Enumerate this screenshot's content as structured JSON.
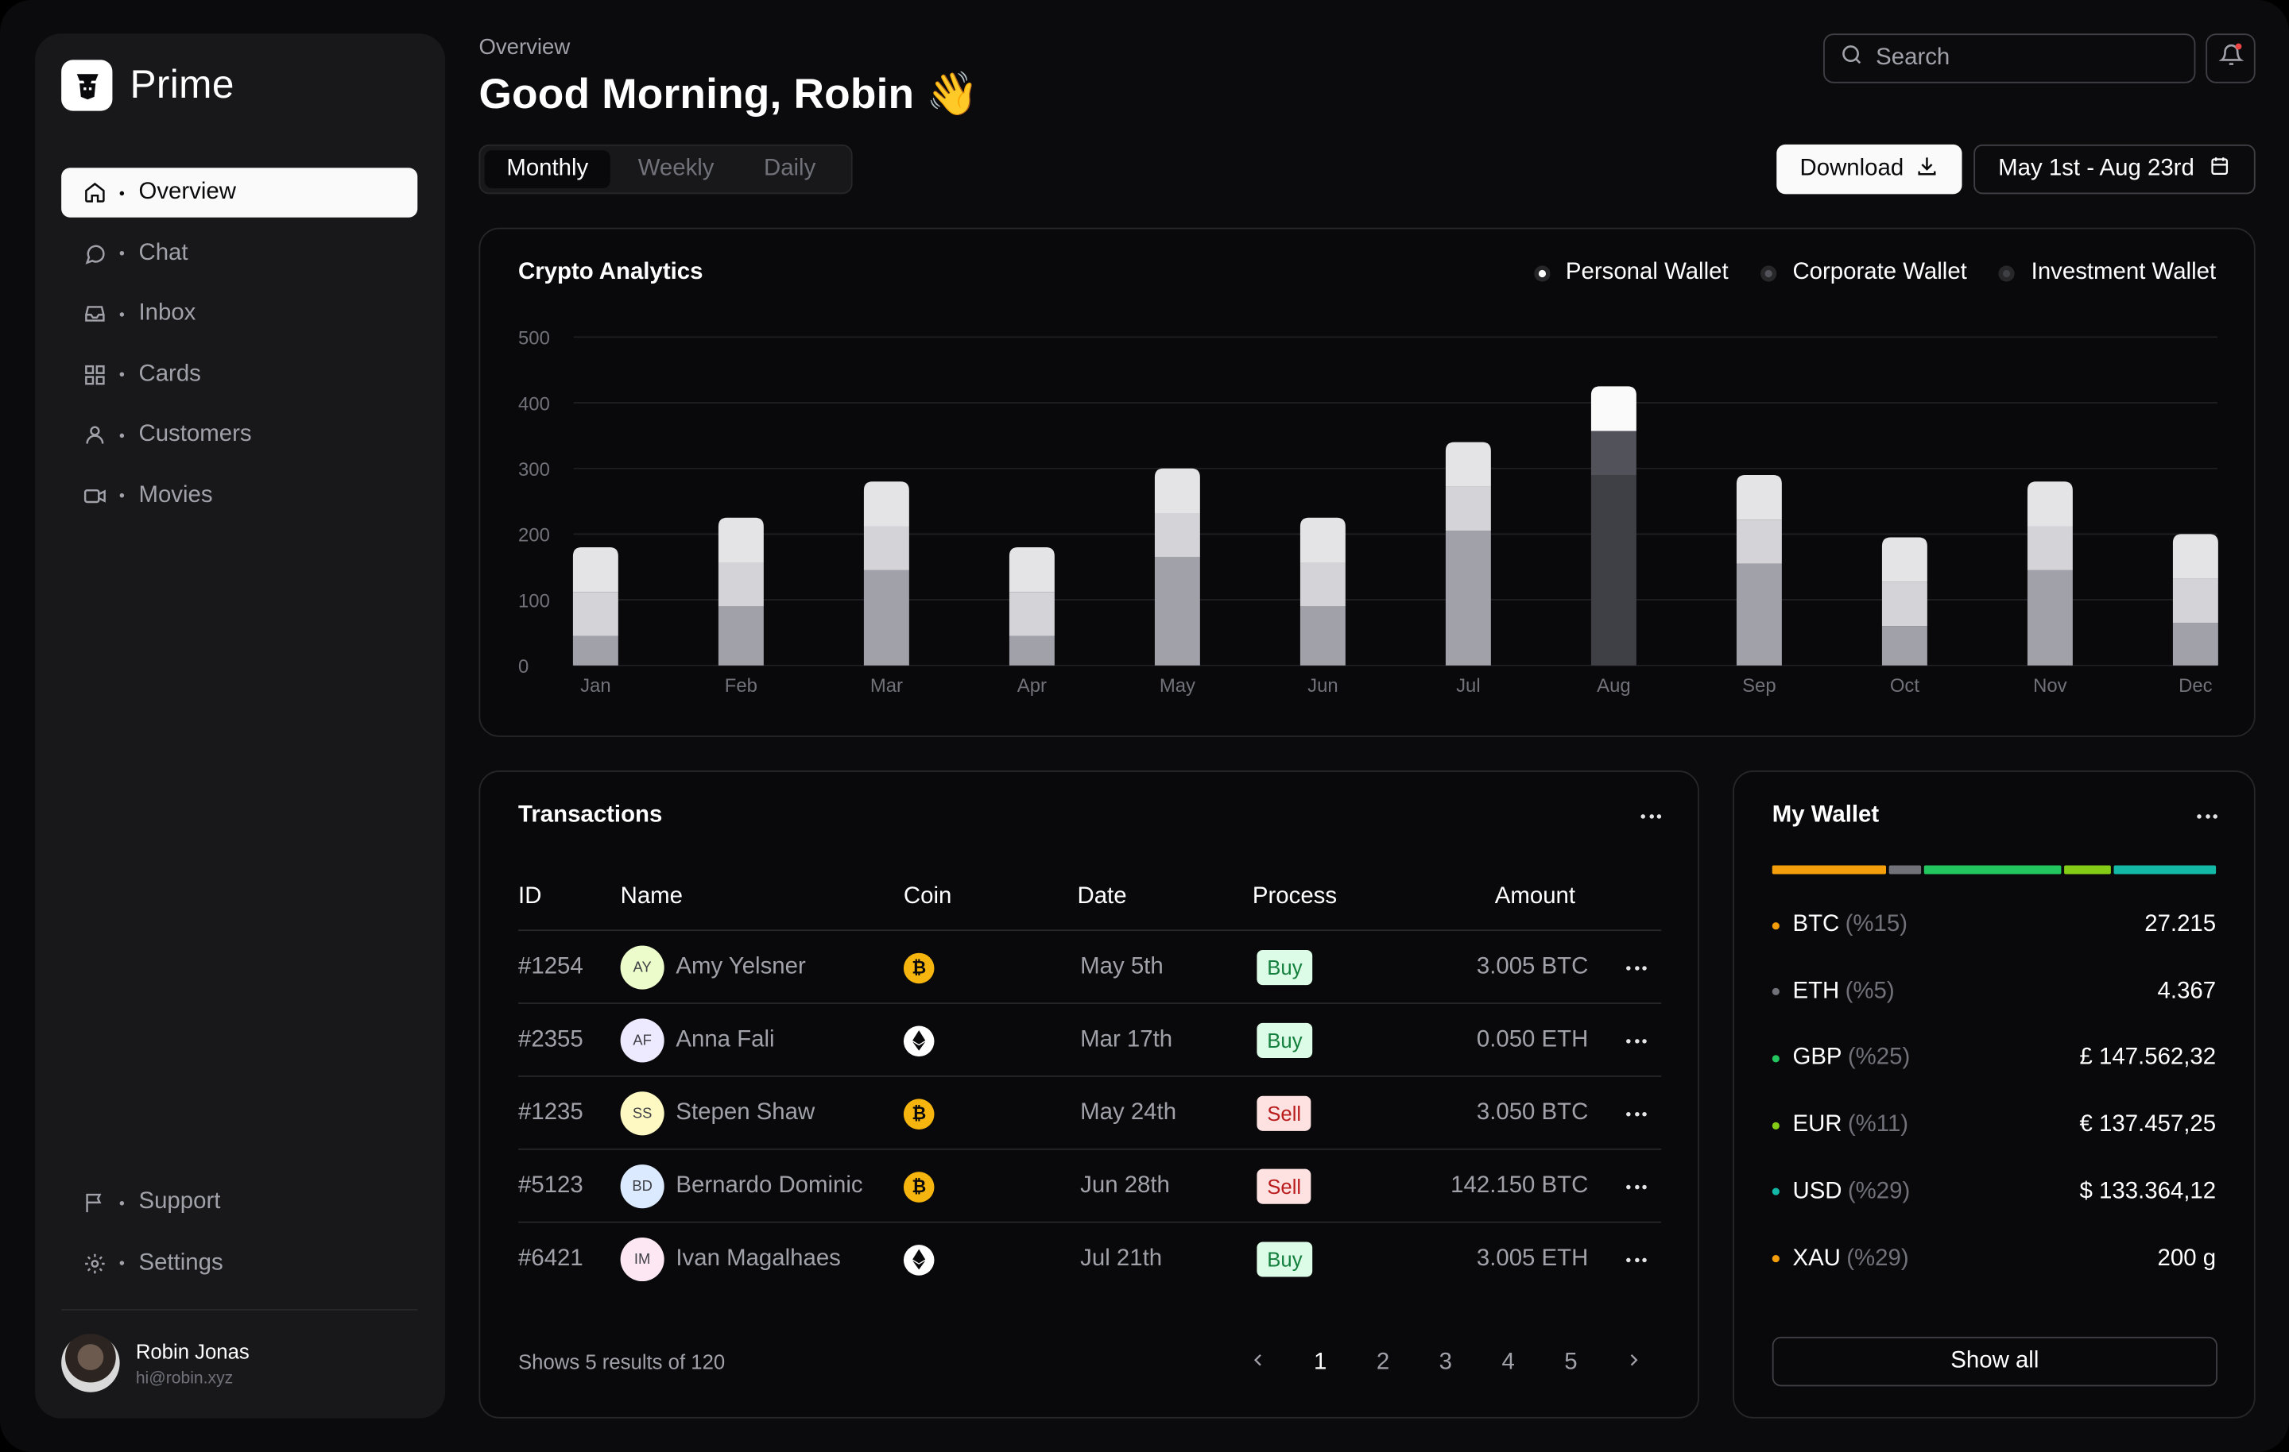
{
  "app": {
    "name": "Prime"
  },
  "sidebar": {
    "items": [
      {
        "label": "Overview",
        "icon": "home-icon"
      },
      {
        "label": "Chat",
        "icon": "chat-icon"
      },
      {
        "label": "Inbox",
        "icon": "inbox-icon"
      },
      {
        "label": "Cards",
        "icon": "grid-icon"
      },
      {
        "label": "Customers",
        "icon": "user-icon"
      },
      {
        "label": "Movies",
        "icon": "video-icon"
      }
    ],
    "bottom_items": [
      {
        "label": "Support",
        "icon": "flag-icon"
      },
      {
        "label": "Settings",
        "icon": "gear-icon"
      }
    ],
    "user": {
      "name": "Robin Jonas",
      "email": "hi@robin.xyz"
    }
  },
  "header": {
    "breadcrumb": "Overview",
    "greeting": "Good Morning, Robin 👋",
    "tabs": [
      "Monthly",
      "Weekly",
      "Daily"
    ],
    "active_tab": "Monthly",
    "search_placeholder": "Search",
    "download_label": "Download",
    "date_range": "May 1st - Aug 23rd"
  },
  "chart_card": {
    "title": "Crypto Analytics",
    "legend": [
      {
        "label": "Personal Wallet",
        "color": "#ffffff"
      },
      {
        "label": "Corporate Wallet",
        "color": "#52525b"
      },
      {
        "label": "Investment Wallet",
        "color": "#3f3f46"
      }
    ]
  },
  "chart_data": {
    "type": "bar",
    "stacked": true,
    "categories": [
      "Jan",
      "Feb",
      "Mar",
      "Apr",
      "May",
      "Jun",
      "Jul",
      "Aug",
      "Sep",
      "Oct",
      "Nov",
      "Dec"
    ],
    "series": [
      {
        "name": "Investment Wallet",
        "values": [
          45,
          90,
          145,
          45,
          165,
          90,
          205,
          290,
          155,
          60,
          145,
          65
        ]
      },
      {
        "name": "Corporate Wallet",
        "values": [
          67,
          67,
          67,
          67,
          67,
          67,
          67,
          67,
          67,
          67,
          67,
          67
        ]
      },
      {
        "name": "Personal Wallet",
        "values": [
          68,
          68,
          68,
          68,
          68,
          68,
          68,
          68,
          68,
          68,
          68,
          68
        ]
      }
    ],
    "yticks": [
      0,
      100,
      200,
      300,
      400,
      500
    ],
    "ylim": [
      0,
      500
    ],
    "highlight": "Aug",
    "grid": true
  },
  "transactions": {
    "title": "Transactions",
    "columns": [
      "ID",
      "Name",
      "Coin",
      "Date",
      "Process",
      "Amount"
    ],
    "rows": [
      {
        "id": "#1254",
        "initials": "AY",
        "name": "Amy Yelsner",
        "coin": "BTC",
        "date": "May 5th",
        "process": "Buy",
        "amount": "3.005 BTC",
        "avatar_color": "#ecfccb"
      },
      {
        "id": "#2355",
        "initials": "AF",
        "name": "Anna Fali",
        "coin": "ETH",
        "date": "Mar 17th",
        "process": "Buy",
        "amount": "0.050 ETH",
        "avatar_color": "#ede9fe"
      },
      {
        "id": "#1235",
        "initials": "SS",
        "name": "Stepen Shaw",
        "coin": "BTC",
        "date": "May 24th",
        "process": "Sell",
        "amount": "3.050 BTC",
        "avatar_color": "#fef9c3"
      },
      {
        "id": "#5123",
        "initials": "BD",
        "name": "Bernardo Dominic",
        "coin": "BTC",
        "date": "Jun 28th",
        "process": "Sell",
        "amount": "142.150 BTC",
        "avatar_color": "#dbeafe"
      },
      {
        "id": "#6421",
        "initials": "IM",
        "name": "Ivan Magalhaes",
        "coin": "ETH",
        "date": "Jul 21th",
        "process": "Buy",
        "amount": "3.005 ETH",
        "avatar_color": "#fce7f3"
      }
    ],
    "summary": "Shows 5 results of 120",
    "pages": [
      "1",
      "2",
      "3",
      "4",
      "5"
    ],
    "current_page": "1"
  },
  "wallet": {
    "title": "My Wallet",
    "items": [
      {
        "code": "BTC",
        "pct": "(%15)",
        "value": "27.215",
        "color": "#f59e0b"
      },
      {
        "code": "ETH",
        "pct": "(%5)",
        "value": "4.367",
        "color": "#71717a"
      },
      {
        "code": "GBP",
        "pct": "(%25)",
        "value": "£ 147.562,32",
        "color": "#22c55e"
      },
      {
        "code": "EUR",
        "pct": "(%11)",
        "value": "€ 137.457,25",
        "color": "#84cc16"
      },
      {
        "code": "USD",
        "pct": "(%29)",
        "value": "$ 133.364,12",
        "color": "#14b8a6"
      },
      {
        "code": "XAU",
        "pct": "(%29)",
        "value": "200 g",
        "color": "#f59e0b"
      }
    ],
    "bar_shares": [
      29,
      8,
      35,
      12,
      26
    ],
    "show_all_label": "Show all"
  }
}
